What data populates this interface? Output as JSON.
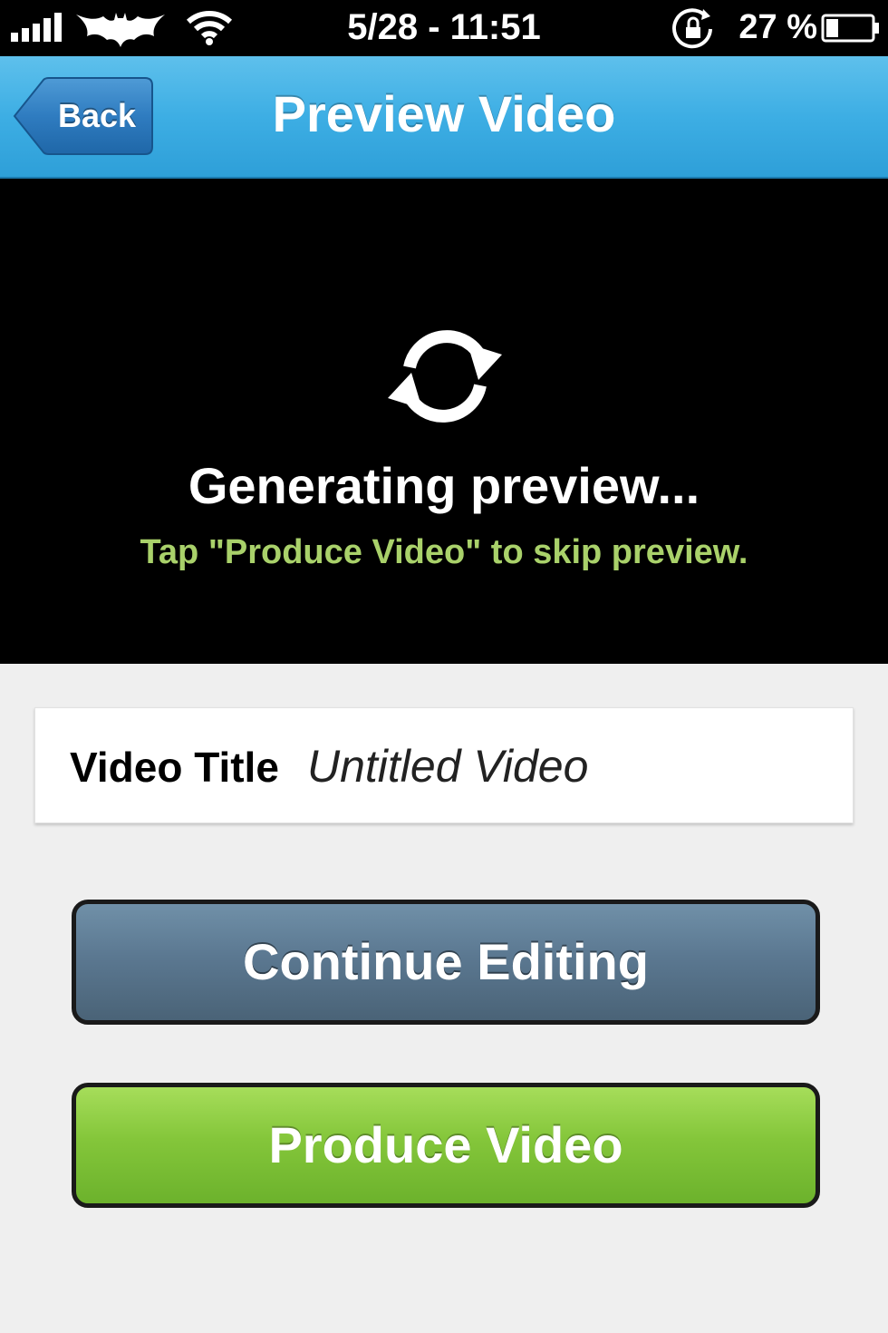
{
  "status_bar": {
    "time": "5/28 - 11:51",
    "battery_percent": "27 %",
    "battery_level": 0.27,
    "icons": [
      "signal-bars-icon",
      "bat-logo-icon",
      "wifi-icon",
      "rotation-lock-icon",
      "battery-icon"
    ]
  },
  "nav": {
    "back_label": "Back",
    "title": "Preview Video",
    "bar_color": "#3daee4"
  },
  "preview": {
    "icon": "refresh-icon",
    "status": "Generating preview...",
    "hint": "Tap \"Produce Video\" to skip preview.",
    "hint_color": "#a9d16a"
  },
  "video_title": {
    "label": "Video Title",
    "placeholder": "Untitled Video"
  },
  "buttons": {
    "continue_label": "Continue Editing",
    "produce_label": "Produce Video",
    "continue_color": "#5b7891",
    "produce_color": "#84c63a"
  }
}
